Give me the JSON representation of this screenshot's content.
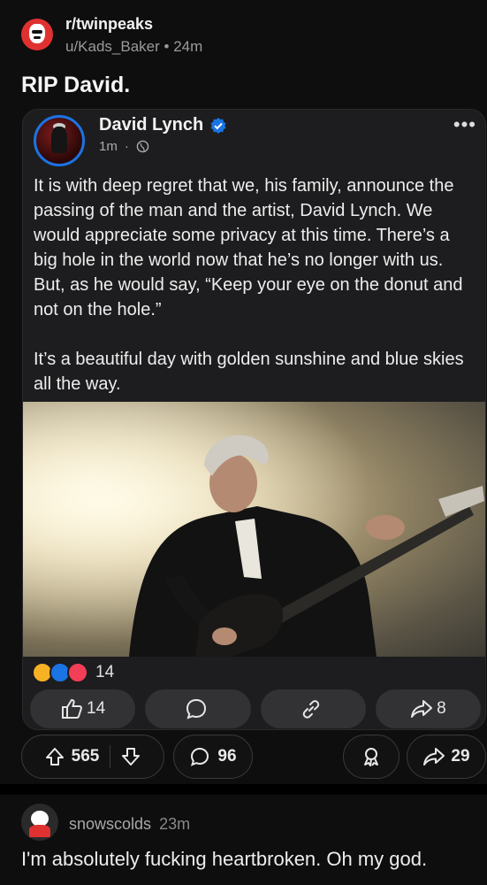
{
  "post": {
    "subreddit": "r/twinpeaks",
    "author": "u/Kads_Baker",
    "separator": "•",
    "age": "24m",
    "title": "RIP David."
  },
  "fb_card": {
    "name": "David Lynch",
    "time": "1m",
    "dot": "·",
    "more": "•••",
    "paragraphs": [
      "It is with deep regret that we, his family, announce the passing of the man and the artist, David Lynch. We would appreciate some privacy at this time. There’s a big hole in the world now that he’s no longer with us.  But, as he would say, “Keep your eye on the donut and not on the hole.”",
      "It’s a beautiful day with golden sunshine and blue skies all the way."
    ],
    "reaction_count": "14",
    "like_count": "14",
    "share_count": "8",
    "colors": {
      "verified": "#1b74e4",
      "love": "#f33e58",
      "care": "#f7b125"
    }
  },
  "reddit_actions": {
    "upvotes": "565",
    "comments": "96",
    "shares": "29"
  },
  "comment": {
    "user": "snowscolds",
    "age": "23m",
    "body": "I'm absolutely fucking heartbroken. Oh my god."
  }
}
